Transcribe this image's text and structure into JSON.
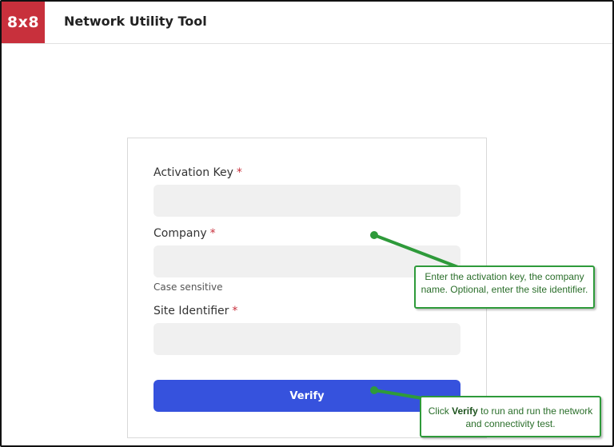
{
  "header": {
    "logo_text": "8x8",
    "title": "Network Utility Tool",
    "brand_color": "#c8303c"
  },
  "form": {
    "activation_key": {
      "label": "Activation Key",
      "required_mark": "*",
      "value": ""
    },
    "company": {
      "label": "Company",
      "required_mark": "*",
      "value": "",
      "hint": "Case sensitive"
    },
    "site_identifier": {
      "label": "Site Identifier",
      "required_mark": "*",
      "value": ""
    },
    "verify_label": "Verify",
    "button_color": "#3652dd"
  },
  "callouts": {
    "fields_note": "Enter the activation key, the company name. Optional, enter the site identifier.",
    "verify_note_prefix": "Click ",
    "verify_note_bold": "Verify",
    "verify_note_suffix": " to run and run the network and connectivity test.",
    "accent_color": "#2e9a3a"
  }
}
